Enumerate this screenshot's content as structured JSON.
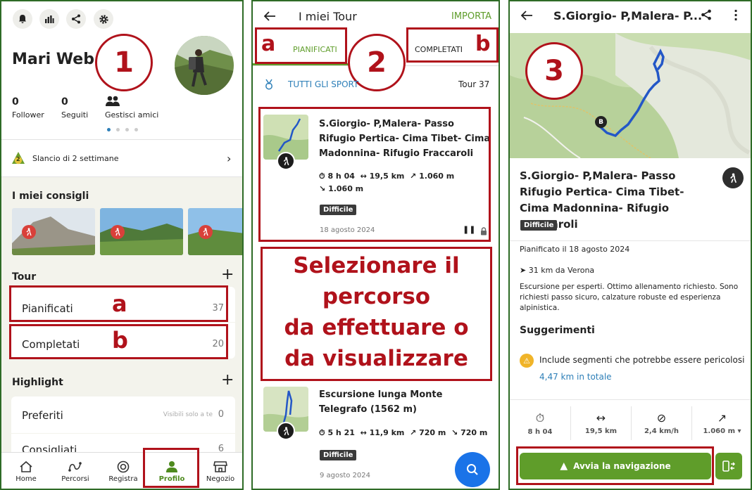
{
  "panel1": {
    "user_name": "Mari Web",
    "step_number": "1",
    "followers": {
      "count": "0",
      "label": "Follower"
    },
    "following": {
      "count": "0",
      "label": "Seguiti"
    },
    "manage_friends_label": "Gestisci amici",
    "streak_badge": "2",
    "streak_label": "Slancio di 2 settimane",
    "tips_heading": "I miei consigli",
    "tour_heading": "Tour",
    "planned_label": "Pianificati",
    "planned_count": "37",
    "planned_marker": "a",
    "completed_label": "Completati",
    "completed_count": "20",
    "completed_marker": "b",
    "highlight_heading": "Highlight",
    "favorites_label": "Preferiti",
    "favorites_note": "Visibili solo a te",
    "favorites_count": "0",
    "recommended_label": "Consigliati",
    "recommended_count": "6",
    "nav": [
      {
        "label": "Home",
        "icon": "home-icon"
      },
      {
        "label": "Percorsi",
        "icon": "route-icon"
      },
      {
        "label": "Registra",
        "icon": "record-icon"
      },
      {
        "label": "Profilo",
        "icon": "profile-icon",
        "active": true
      },
      {
        "label": "Negozio",
        "icon": "shop-icon"
      }
    ]
  },
  "panel2": {
    "title": "I miei Tour",
    "import_label": "IMPORTA",
    "tab_planned": "PIANIFICATI",
    "tab_completed": "COMPLETATI",
    "marker_a": "a",
    "marker_b": "b",
    "step_number": "2",
    "sport_filter": "TUTTI GLI SPORT",
    "tour_count": "Tour 37",
    "tour1": {
      "title": "S.Giorgio- P,Malera- Passo Rifugio Pertica- Cima Tibet- Cima Madonnina- Rifugio Fraccaroli",
      "duration": "8 h 04",
      "distance": "19,5 km",
      "ascent": "1.060 m",
      "descent": "1.060 m",
      "difficulty": "Difficile",
      "date": "18 agosto 2024"
    },
    "instruction": [
      "Selezionare il",
      "percorso",
      "da effettuare o",
      "da visualizzare"
    ],
    "tour2": {
      "title": "Escursione lunga Monte Telegrafo (1562 m)",
      "duration": "5 h 21",
      "distance": "11,9 km",
      "ascent": "720 m",
      "descent": "720 m",
      "difficulty": "Difficile",
      "date": "9 agosto 2024"
    }
  },
  "panel3": {
    "header_title": "S.Giorgio- P,Malera- P...",
    "step_number": "3",
    "map_marker": "B",
    "title": "S.Giorgio- P,Malera- Passo Rifugio Pertica- Cima Tibet- Cima Madonnina- Rifugio Fraccaroli",
    "difficulty": "Difficile",
    "planned_on": "Pianificato il 18 agosto 2024",
    "distance_from": "31 km da Verona",
    "description": "Escursione per esperti. Ottimo allenamento richiesto. Sono richiesti passo sicuro, calzature robuste ed esperienza alpinistica.",
    "tips_heading": "Suggerimenti",
    "warning_text": "Include segmenti che potrebbe essere pericolosi",
    "warning_total": "4,47 km in totale",
    "stats": [
      {
        "icon": "timer-icon",
        "value": "8 h 04"
      },
      {
        "icon": "distance-icon",
        "value": "19,5 km"
      },
      {
        "icon": "speed-icon",
        "value": "2,4 km/h"
      },
      {
        "icon": "ascent-icon",
        "value": "1.060 m"
      }
    ],
    "nav_button": "Avvia la navigazione"
  },
  "colors": {
    "accent_green": "#5f9d2a",
    "annotation_red": "#b0121b",
    "link_blue": "#2d7fb8",
    "fab_blue": "#1a73e8"
  }
}
